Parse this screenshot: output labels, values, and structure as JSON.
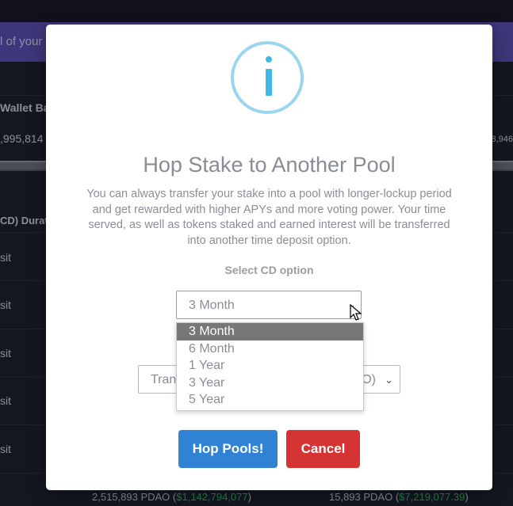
{
  "background": {
    "banner_text": "l of your",
    "header_wallet": "Wallet Bal",
    "wallet_value_left": ",995,814",
    "wallet_value_right": "8,946",
    "header_duration": "CD) Durat",
    "deposit_cells": [
      "sit",
      "sit",
      "sit",
      "sit",
      "sit"
    ],
    "bottom_left": "2,515,893 PDAO",
    "bottom_left_sub": "$1,142,794,077",
    "bottom_right": "15,893 PDAO",
    "bottom_right_sub": "$7,219,077.39"
  },
  "modal": {
    "icon": "info-icon",
    "title": "Hop Stake to Another Pool",
    "description": "You can always transfer your stake into a pool with longer-lockup period and get rewarded with higher APYs and more voting power. Your time served, as well as tokens staked and earned interest will be transferred into another time deposit option.",
    "select_label": "Select CD option",
    "select_value": "3 Month",
    "options": [
      "3 Month",
      "6 Month",
      "1 Year",
      "3 Year",
      "5 Year"
    ],
    "selected_index": 0,
    "transfer_select_left": "Tran",
    "transfer_select_right": "O)",
    "primary_button": "Hop Pools!",
    "cancel_button": "Cancel"
  },
  "colors": {
    "primary": "#3083d4",
    "danger": "#d63333",
    "info": "#3fb8e8",
    "banner": "#5a4fb4",
    "positive": "#2fbd63"
  }
}
